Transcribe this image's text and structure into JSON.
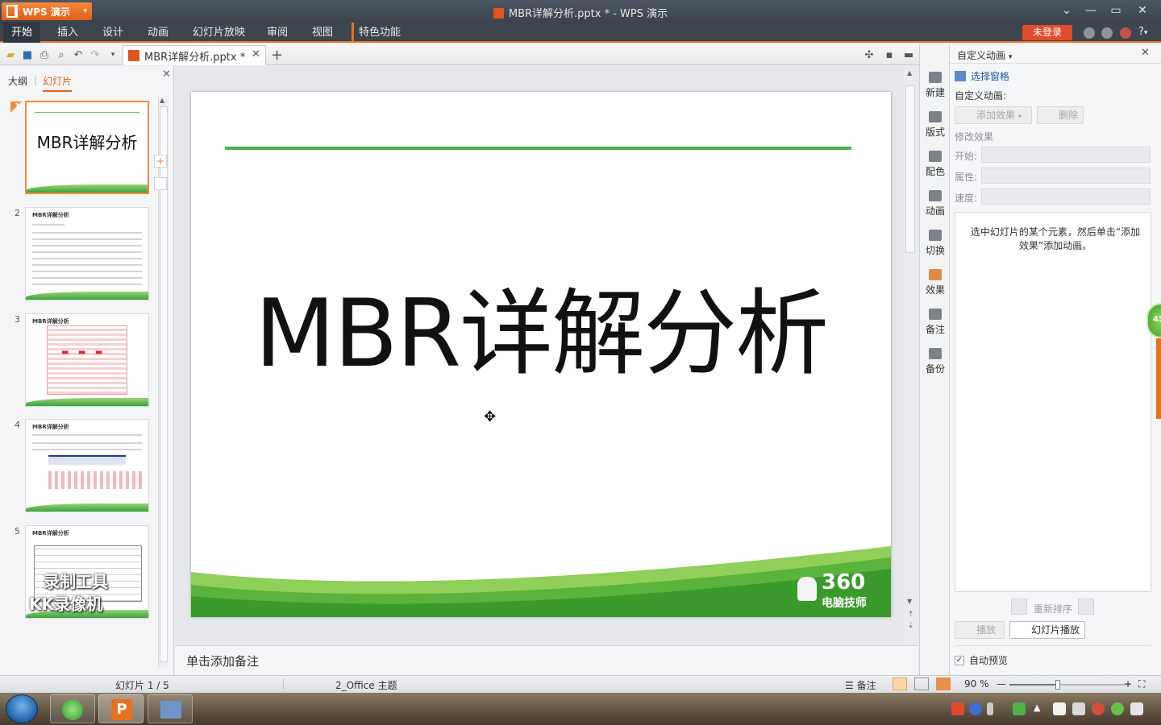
{
  "app": {
    "name": "WPS 演示",
    "window_title": "MBR详解分析.pptx * - WPS 演示"
  },
  "menu": {
    "tabs": [
      "开始",
      "插入",
      "设计",
      "动画",
      "幻灯片放映",
      "审阅",
      "视图",
      "特色功能"
    ],
    "active_tab": "开始",
    "login_label": "未登录",
    "help_label": "?"
  },
  "document_tab": {
    "filename": "MBR详解分析.pptx *",
    "close_label": "✕",
    "new_tab_label": "+"
  },
  "left_panel": {
    "tabs": [
      "大纲",
      "幻灯片"
    ],
    "active_tab": "幻灯片",
    "close_label": "✕",
    "thumbnails": [
      {
        "number": "1",
        "title": "MBR详解分析"
      },
      {
        "number": "2",
        "title": "MBR详解分析"
      },
      {
        "number": "3",
        "title": "MBR详解分析"
      },
      {
        "number": "4",
        "title": "MBR详解分析"
      },
      {
        "number": "5",
        "title": "MBR详解分析"
      }
    ],
    "watermark_lines": [
      "录制工具",
      "KK录像机"
    ]
  },
  "slide": {
    "title": "MBR详解分析",
    "logo_number": "360",
    "logo_text": "电脑技师"
  },
  "notes": {
    "placeholder": "单击添加备注"
  },
  "task_rail": {
    "items": [
      "新建",
      "版式",
      "配色",
      "动画",
      "切换",
      "效果",
      "备注",
      "备份"
    ]
  },
  "animation_pane": {
    "title": "自定义动画",
    "select_pane_link": "选择窗格",
    "custom_animation_label": "自定义动画:",
    "add_effect_label": "添加效果",
    "delete_label": "删除",
    "modify_effect_label": "修改效果",
    "start_label": "开始:",
    "property_label": "属性:",
    "speed_label": "速度:",
    "hint": "选中幻灯片的某个元素，然后单击“添加效果”添加动画。",
    "reorder_label": "重新排序",
    "play_label": "播放",
    "slideshow_label": "幻灯片播放",
    "auto_preview_label": "自动预览",
    "auto_preview_checked": true,
    "badge": "45"
  },
  "statusbar": {
    "slide_indicator": "幻灯片 1 / 5",
    "theme": "2_Office 主题",
    "notes_label": "备注",
    "zoom": "90 %",
    "zoom_fraction": 0.4
  },
  "colors": {
    "accent": "#e8701f",
    "slide_green": "#4caf50",
    "login_red": "#e24b2b"
  }
}
